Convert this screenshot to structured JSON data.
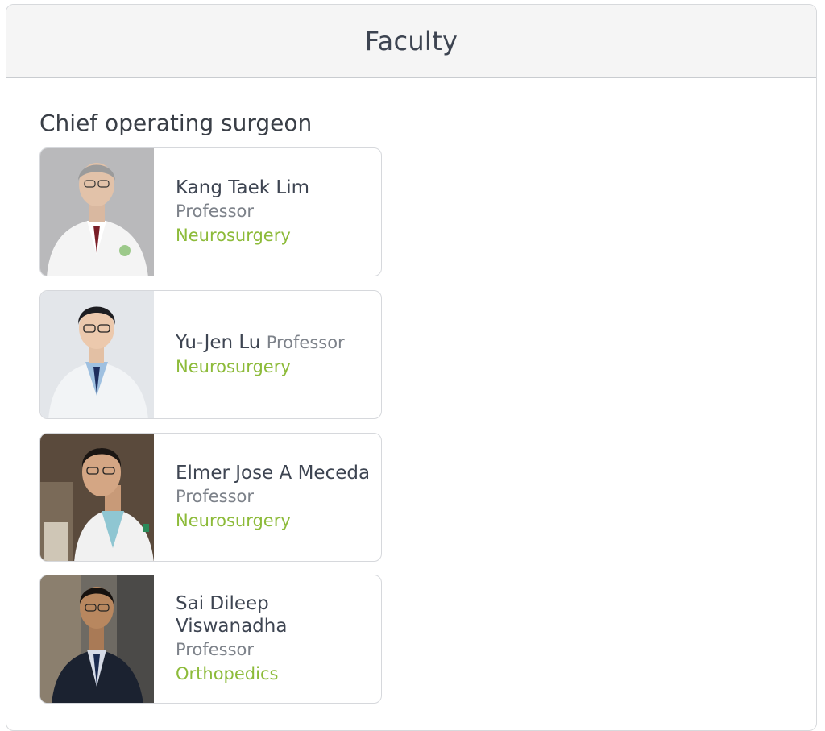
{
  "header": {
    "title": "Faculty"
  },
  "section": {
    "title": "Chief operating surgeon"
  },
  "faculty": [
    {
      "name": "Kang Taek Lim",
      "title": "Professor",
      "department": "Neurosurgery"
    },
    {
      "name": "Yu-Jen Lu",
      "title": "Professor",
      "department": "Neurosurgery"
    },
    {
      "name": "Elmer Jose A Meceda",
      "title": "Professor",
      "department": "Neurosurgery"
    },
    {
      "name": "Sai Dileep Viswanadha",
      "title": "Professor",
      "department": "Orthopedics"
    }
  ],
  "colors": {
    "accent": "#8dbb3a",
    "name": "#3e4552",
    "muted": "#7d828a"
  }
}
